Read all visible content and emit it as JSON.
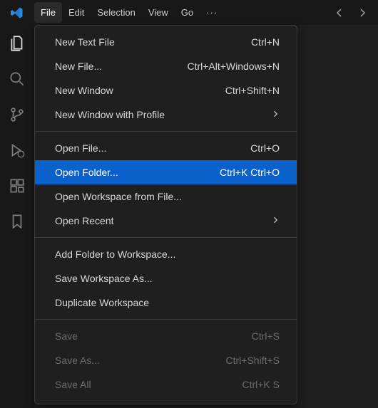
{
  "menuBar": {
    "file": "File",
    "edit": "Edit",
    "selection": "Selection",
    "view": "View",
    "go": "Go",
    "more": "···"
  },
  "icons": {
    "logo": "vscode-logo",
    "back": "←",
    "forward": "→"
  },
  "activity": {
    "explorer": "explorer-icon",
    "search": "search-icon",
    "scm": "source-control-icon",
    "debug": "run-debug-icon",
    "extensions": "extensions-icon",
    "bookmarks": "bookmarks-icon"
  },
  "fileMenu": {
    "newTextFile": {
      "label": "New Text File",
      "shortcut": "Ctrl+N"
    },
    "newFile": {
      "label": "New File...",
      "shortcut": "Ctrl+Alt+Windows+N"
    },
    "newWindow": {
      "label": "New Window",
      "shortcut": "Ctrl+Shift+N"
    },
    "newWindowProfile": {
      "label": "New Window with Profile",
      "submenu": true
    },
    "openFile": {
      "label": "Open File...",
      "shortcut": "Ctrl+O"
    },
    "openFolder": {
      "label": "Open Folder...",
      "shortcut": "Ctrl+K Ctrl+O",
      "highlight": true
    },
    "openWorkspace": {
      "label": "Open Workspace from File..."
    },
    "openRecent": {
      "label": "Open Recent",
      "submenu": true
    },
    "addFolder": {
      "label": "Add Folder to Workspace..."
    },
    "saveWorkspaceAs": {
      "label": "Save Workspace As..."
    },
    "duplicateWorkspace": {
      "label": "Duplicate Workspace"
    },
    "save": {
      "label": "Save",
      "shortcut": "Ctrl+S",
      "disabled": true
    },
    "saveAs": {
      "label": "Save As...",
      "shortcut": "Ctrl+Shift+S",
      "disabled": true
    },
    "saveAll": {
      "label": "Save All",
      "shortcut": "Ctrl+K S",
      "disabled": true
    }
  }
}
